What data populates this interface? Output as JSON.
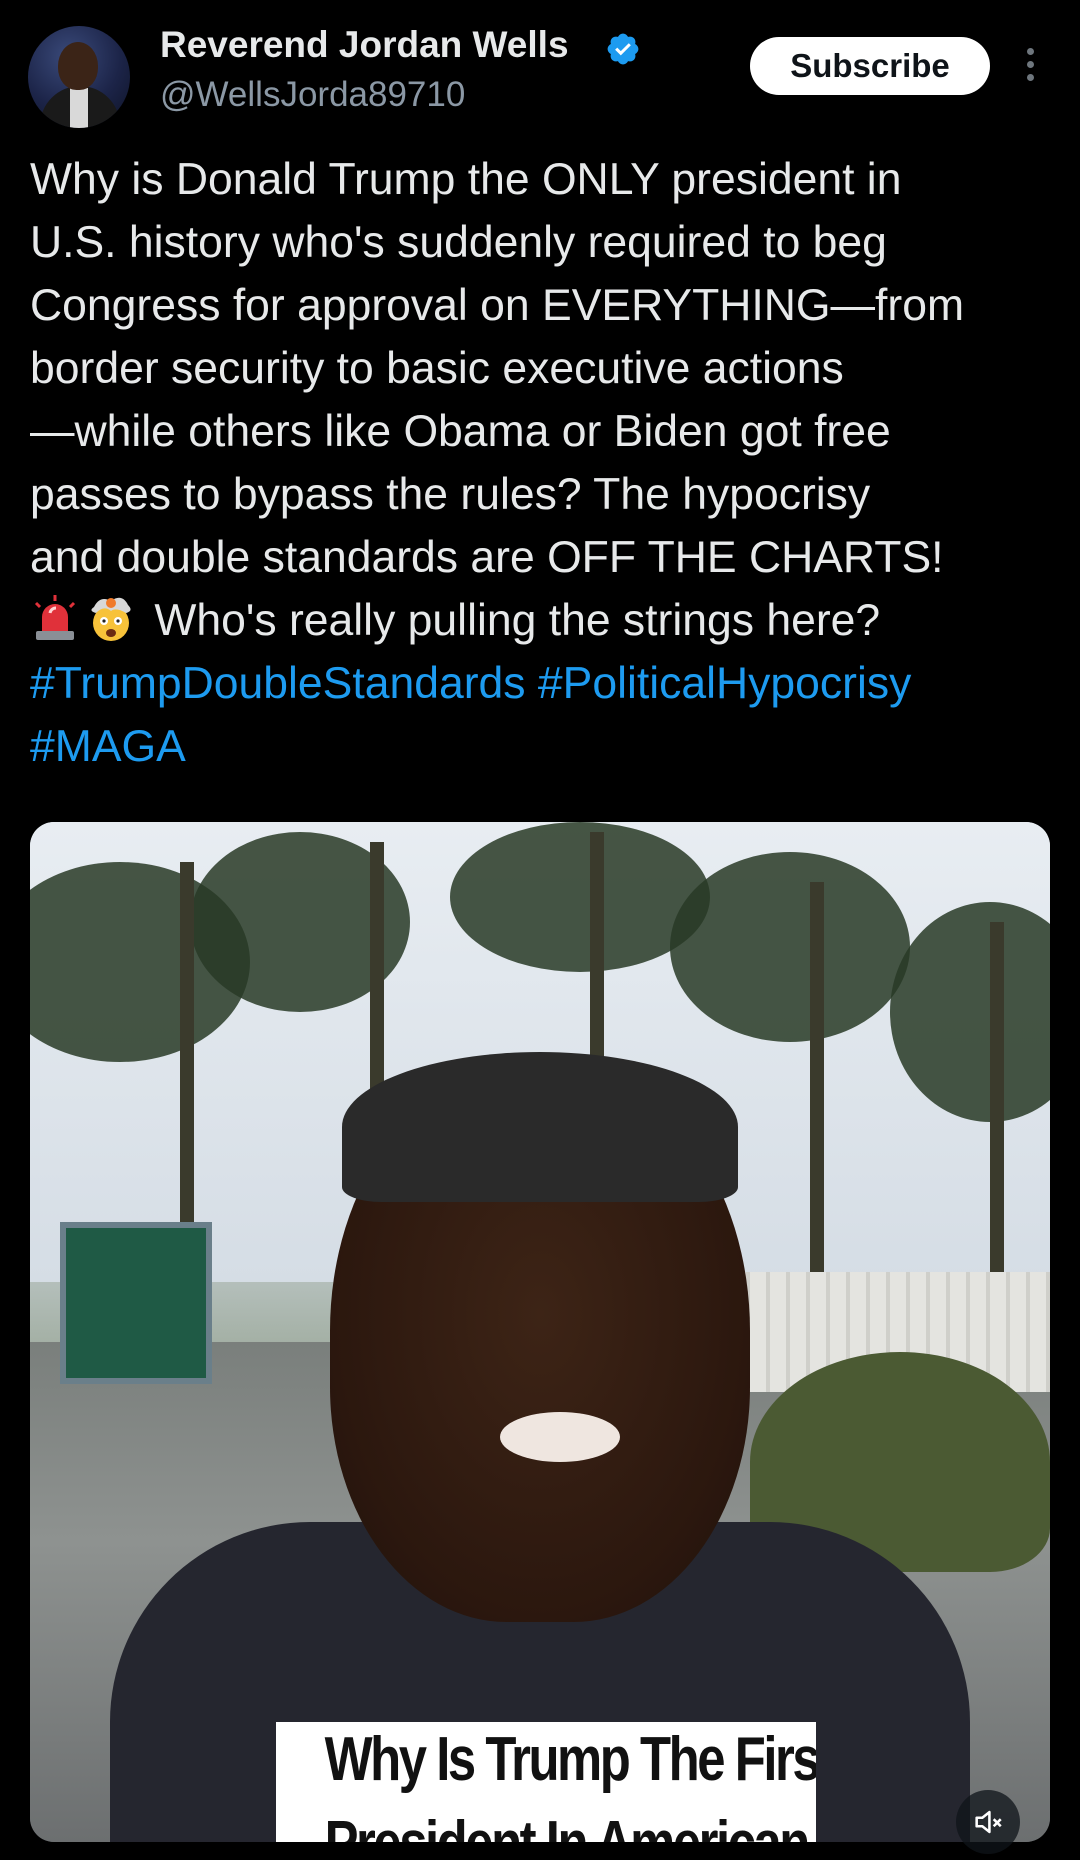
{
  "top_cut_text": "",
  "author": {
    "display_name": "Reverend Jordan Wells",
    "handle": "@WellsJorda89710",
    "verified": true
  },
  "actions": {
    "subscribe_label": "Subscribe",
    "more_icon": "more-vertical-icon"
  },
  "tweet": {
    "lines": [
      "Why is Donald Trump the ONLY president in",
      "U.S. history who's suddenly required to beg",
      "Congress for approval on EVERYTHING—from",
      "border security to basic executive actions",
      "—while others like Obama or Biden got free",
      "passes to bypass the rules? The hypocrisy",
      "and double standards are OFF THE CHARTS!"
    ],
    "emoji_line_text": "Who's really pulling the strings here?",
    "emojis": [
      "rotating-light-emoji",
      "exploding-head-emoji"
    ],
    "hashtags": [
      "#TrumpDoubleStandards",
      "#PoliticalHypocrisy",
      "#MAGA"
    ]
  },
  "media": {
    "caption_line1": "Why Is Trump The First",
    "caption_line2": "President In American",
    "mute_icon": "speaker-muted-icon"
  },
  "colors": {
    "background": "#000000",
    "text": "#e7e9ea",
    "secondary": "#8b98a5",
    "link": "#1d9bf0",
    "verified": "#1d9bf0"
  }
}
